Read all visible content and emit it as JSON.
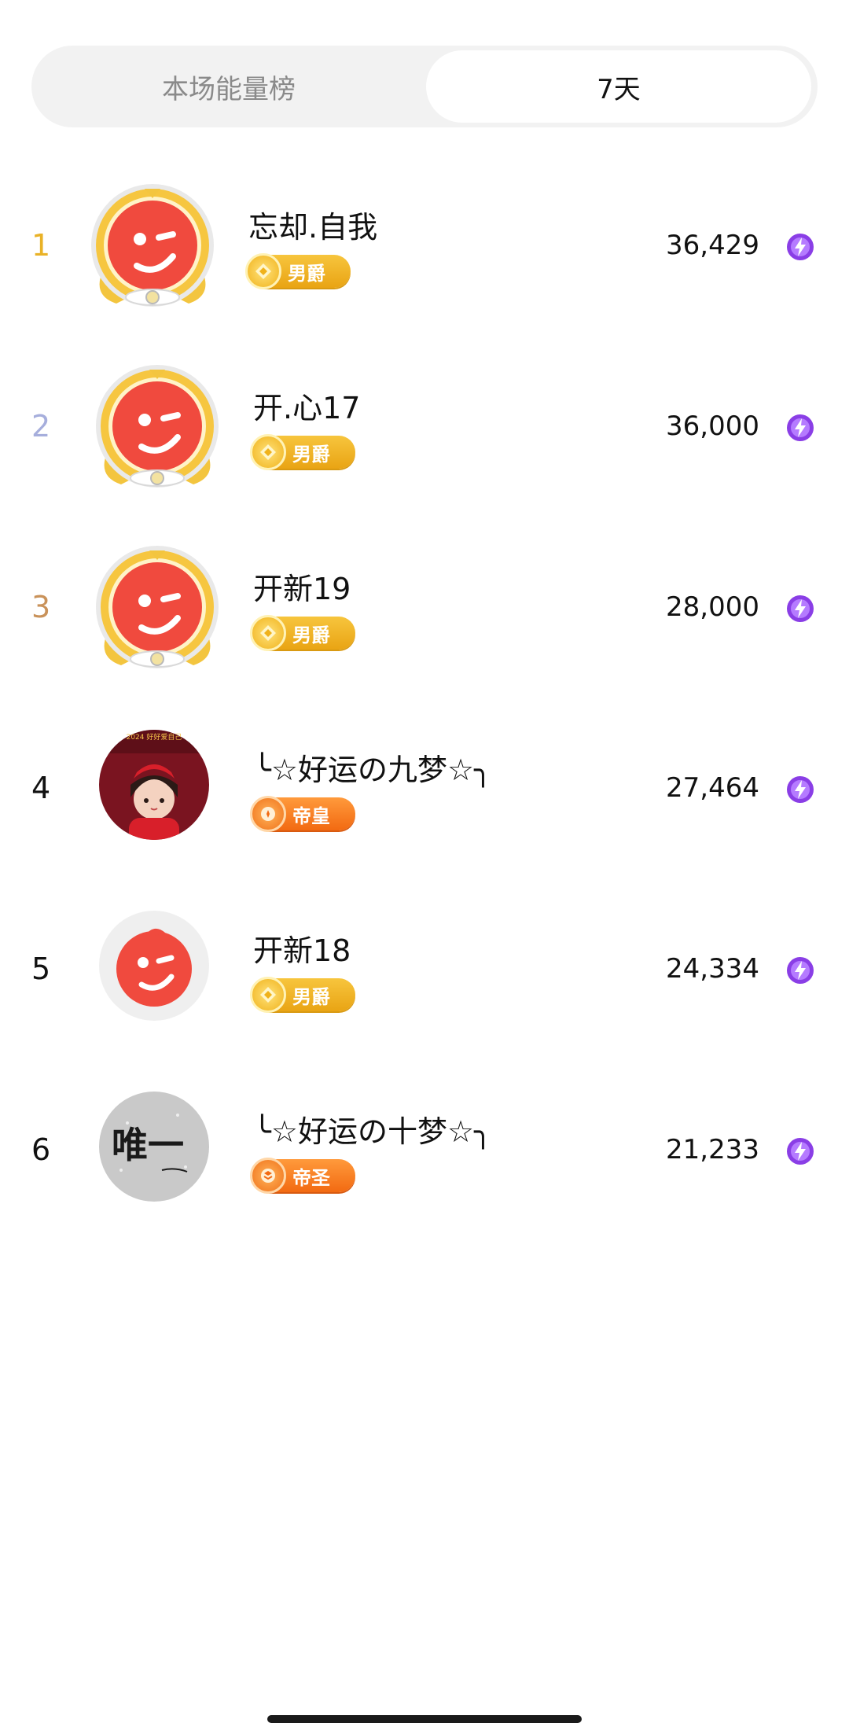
{
  "tabs": [
    {
      "label": "本场能量榜",
      "active": false
    },
    {
      "label": "7天",
      "active": true
    }
  ],
  "rows": [
    {
      "rank": "1",
      "name": "忘却.自我",
      "badge": "男爵",
      "score": "36,429"
    },
    {
      "rank": "2",
      "name": "开.心17",
      "badge": "男爵",
      "score": "36,000"
    },
    {
      "rank": "3",
      "name": "开新19",
      "badge": "男爵",
      "score": "28,000"
    },
    {
      "rank": "4",
      "name": "╰☆好运の九梦☆╮",
      "badge": "帝皇",
      "score": "27,464"
    },
    {
      "rank": "5",
      "name": "开新18",
      "badge": "男爵",
      "score": "24,334"
    },
    {
      "rank": "6",
      "name": "╰☆好运の十梦☆╮",
      "badge": "帝圣",
      "score": "21,233"
    }
  ],
  "avatar_images": {
    "rank4": "2024 好好爱自己",
    "rank6": "唯一"
  },
  "colors": {
    "gold_rank": "#e9b227",
    "silver_rank": "#a6aedc",
    "bronze_rank": "#c9925a",
    "avatar_red": "#f04a3e",
    "badge_yellow": "#f0b21b",
    "badge_orange": "#f26a12",
    "energy_purple": "#8a3ee6"
  }
}
